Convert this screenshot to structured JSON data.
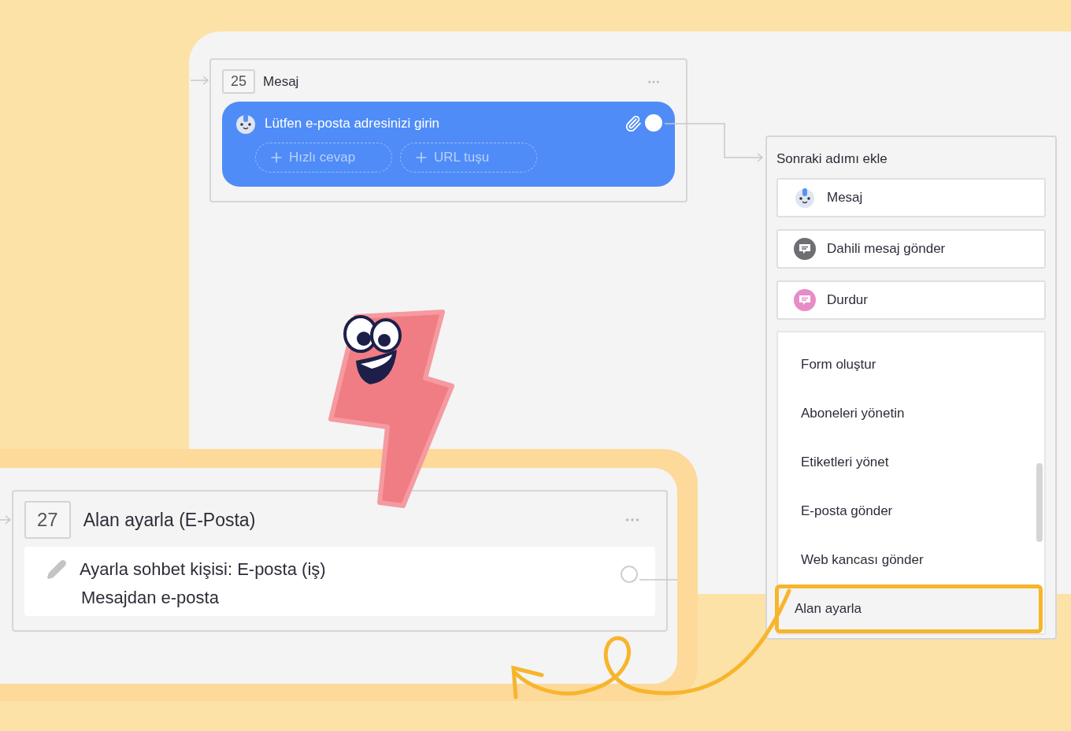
{
  "nodes": [
    {
      "kind": "message",
      "number": "25",
      "title": "Mesaj",
      "text": "Lütfen e-posta adresinizi girin",
      "buttons": [
        "Hızlı cevap",
        "URL tuşu"
      ]
    },
    {
      "kind": "action",
      "number": "27",
      "title": "Alan ayarla (E-Posta)",
      "action": "Ayarla sohbet kişisi: E-posta (iş)",
      "detail": "Mesajdan e-posta"
    }
  ],
  "next_step": {
    "title": "Sonraki adımı ekle",
    "options": [
      {
        "kind": "message",
        "label": "Mesaj"
      },
      {
        "kind": "internal",
        "label": "Dahili mesaj gönder"
      },
      {
        "kind": "stop",
        "label": "Durdur"
      }
    ],
    "menu": [
      {
        "label": "Form oluştur",
        "selected": false
      },
      {
        "label": "Aboneleri yönetin",
        "selected": false
      },
      {
        "label": "Etiketleri yönet",
        "selected": false
      },
      {
        "label": "E-posta gönder",
        "selected": false
      },
      {
        "label": "Web kancası gönder",
        "selected": false
      },
      {
        "label": "Alan ayarla",
        "selected": true
      }
    ]
  }
}
